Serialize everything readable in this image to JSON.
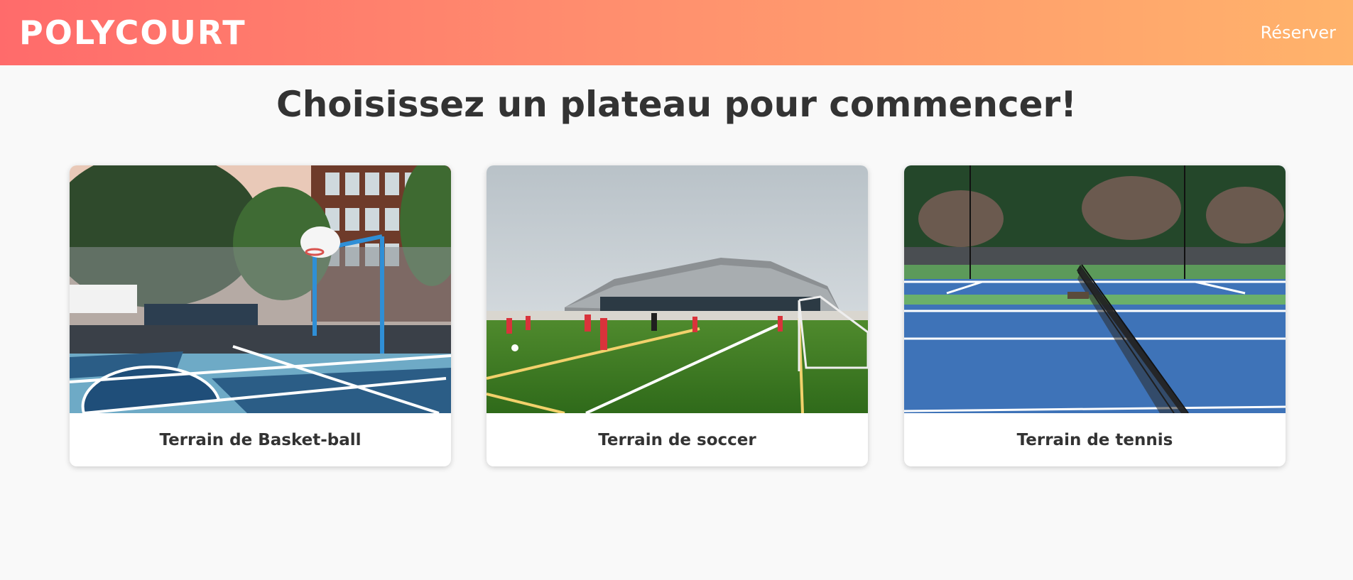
{
  "header": {
    "brand": "POLYCOURT",
    "nav_reserve": "Réserver"
  },
  "main": {
    "title": "Choisissez un plateau pour commencer!",
    "cards": [
      {
        "label": "Terrain de Basket-ball",
        "image": "basketball-court-photo"
      },
      {
        "label": "Terrain de soccer",
        "image": "soccer-field-photo"
      },
      {
        "label": "Terrain de tennis",
        "image": "tennis-court-photo"
      }
    ]
  },
  "colors": {
    "header_gradient_start": "#ff6b6b",
    "header_gradient_end": "#ffb36b",
    "page_background": "#f9f9f9",
    "text": "#333333"
  }
}
